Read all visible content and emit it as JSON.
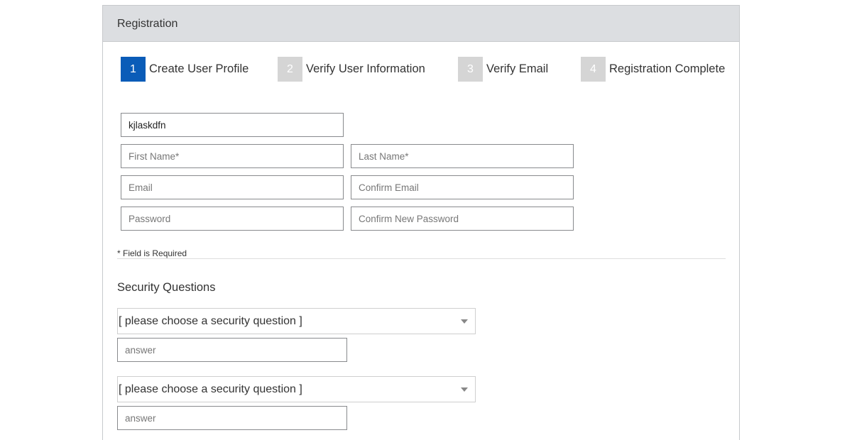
{
  "panel": {
    "title": "Registration"
  },
  "steps": [
    {
      "number": "1",
      "label": "Create User Profile",
      "active": true
    },
    {
      "number": "2",
      "label": "Verify User Information",
      "active": false
    },
    {
      "number": "3",
      "label": "Verify Email",
      "active": false
    },
    {
      "number": "4",
      "label": "Registration Complete",
      "active": false
    }
  ],
  "form": {
    "username": {
      "value": "kjlaskdfn"
    },
    "first_name": {
      "placeholder": "First Name*",
      "value": ""
    },
    "last_name": {
      "placeholder": "Last Name*",
      "value": ""
    },
    "email": {
      "placeholder": "Email",
      "value": ""
    },
    "confirm_email": {
      "placeholder": "Confirm Email",
      "value": ""
    },
    "password": {
      "placeholder": "Password",
      "value": ""
    },
    "confirm_password": {
      "placeholder": "Confirm New Password",
      "value": ""
    },
    "required_note": "* Field is Required"
  },
  "security": {
    "title": "Security Questions",
    "questions": [
      {
        "selected": "[ please choose a security question ]",
        "answer_placeholder": "answer"
      },
      {
        "selected": "[ please choose a security question ]",
        "answer_placeholder": "answer"
      }
    ]
  },
  "colors": {
    "active_step": "#0a5cb8",
    "inactive_step": "#d5d5d5",
    "header_bg": "#dcdee1"
  },
  "icons": {
    "select_arrow": "chevron-down-icon"
  }
}
